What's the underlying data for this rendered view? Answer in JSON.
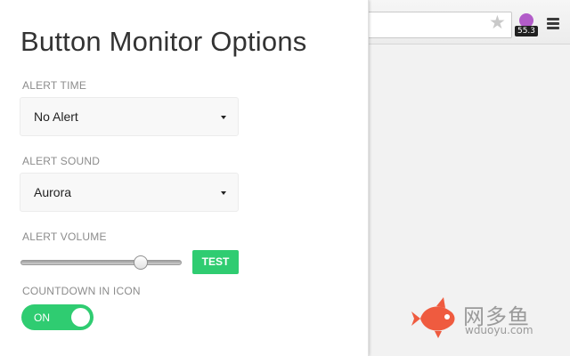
{
  "popup": {
    "title": "Button Monitor Options",
    "alert_time": {
      "label": "ALERT TIME",
      "value": "No Alert"
    },
    "alert_sound": {
      "label": "ALERT SOUND",
      "value": "Aurora"
    },
    "alert_volume": {
      "label": "ALERT VOLUME",
      "level": 0.77,
      "test_label": "TEST"
    },
    "countdown_in_icon": {
      "label": "COUNTDOWN IN ICON",
      "state_label": "ON",
      "enabled": true
    }
  },
  "browser": {
    "extension_badge": "55.3",
    "icons": [
      "star-icon",
      "extension-icon",
      "menu-icon"
    ]
  },
  "watermark": {
    "text": "网多鱼",
    "sub": "wduoyu.com"
  },
  "colors": {
    "accent": "#2fcc71",
    "extension": "#b25cc9"
  }
}
